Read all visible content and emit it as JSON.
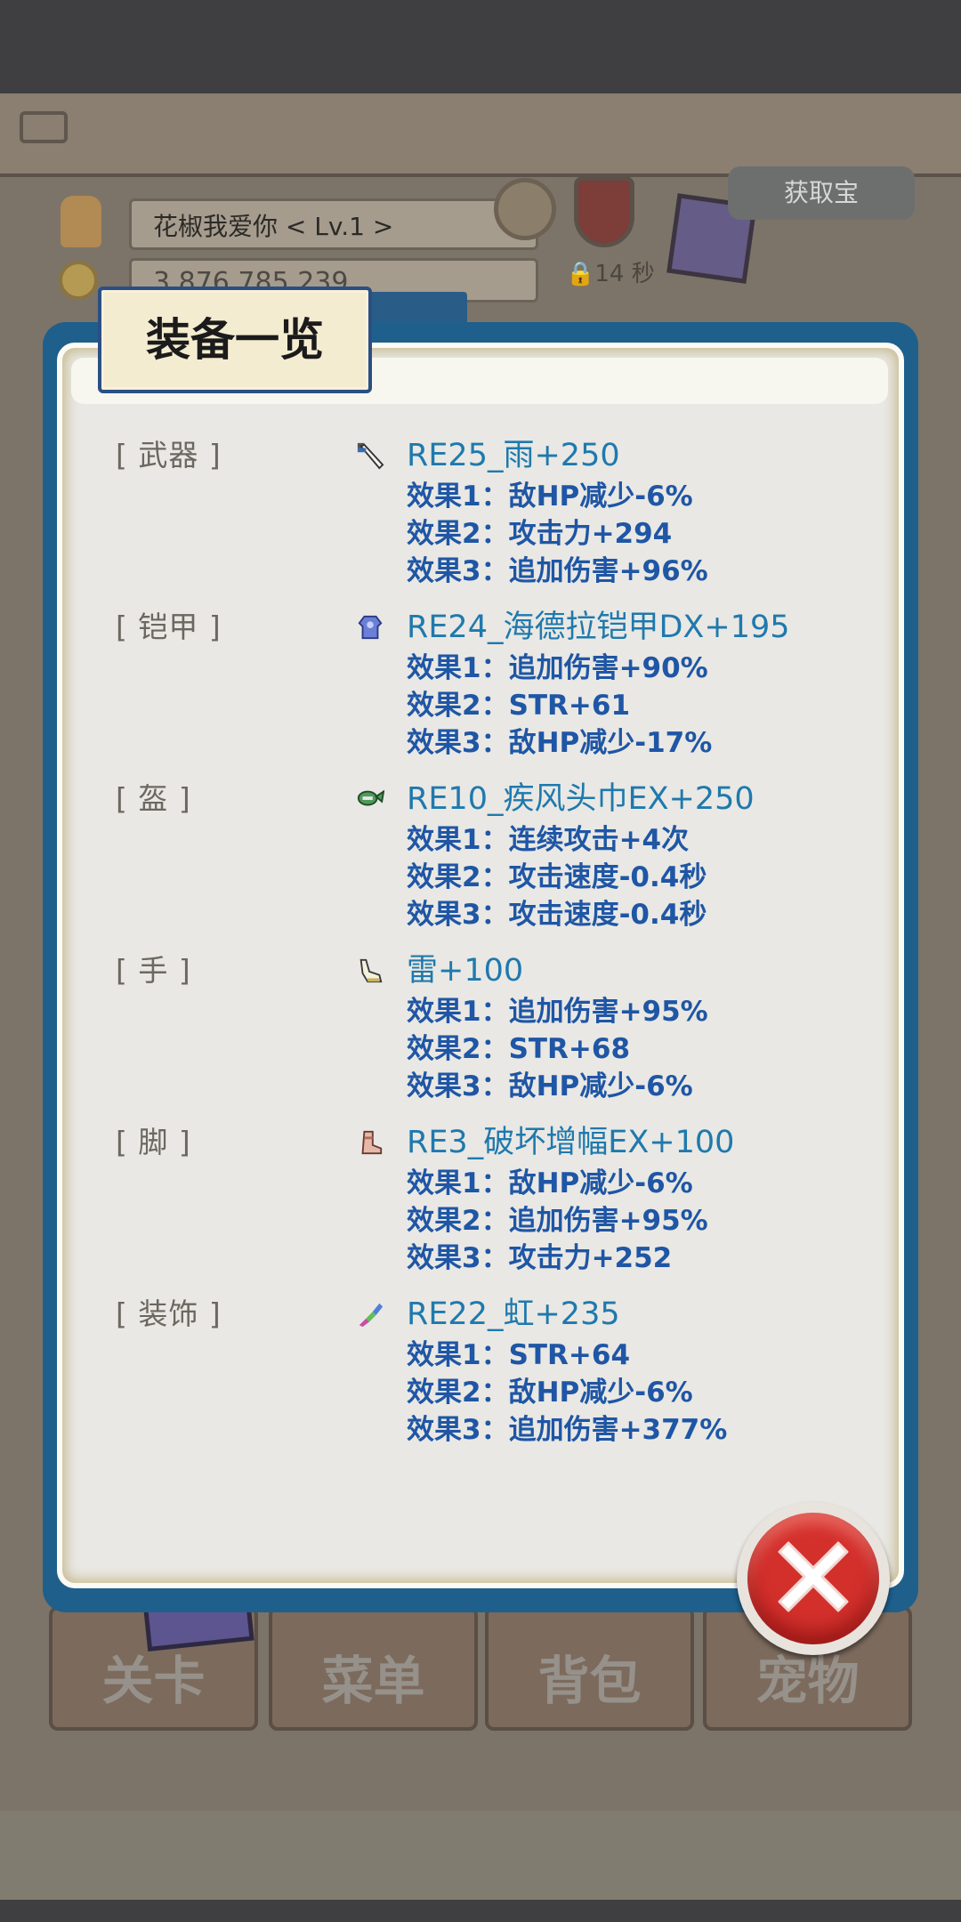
{
  "background": {
    "player_name": "花椒我爱你    < Lv.1 >",
    "gold": "3,876,785,239",
    "timer": "14 秒",
    "top_right_button": "获取宝",
    "tabs": [
      "关卡",
      "菜单",
      "背包",
      "宠物"
    ]
  },
  "dialog": {
    "title": "装备一览",
    "slots": [
      {
        "label": "[ 武器 ]",
        "icon": "sword-icon",
        "item": "RE25_雨+250",
        "effects": [
          "效果1：敌HP减少-6%",
          "效果2：攻击力+294",
          "效果3：追加伤害+96%"
        ]
      },
      {
        "label": "[ 铠甲 ]",
        "icon": "armor-icon",
        "item": "RE24_海德拉铠甲DX+195",
        "effects": [
          "效果1：追加伤害+90%",
          "效果2：STR+61",
          "效果3：敌HP减少-17%"
        ]
      },
      {
        "label": "[ 盔 ]",
        "icon": "helmet-icon",
        "item": "RE10_疾风头巾EX+250",
        "effects": [
          "效果1：连续攻击+4次",
          "效果2：攻击速度-0.4秒",
          "效果3：攻击速度-0.4秒"
        ]
      },
      {
        "label": "[ 手 ]",
        "icon": "glove-icon",
        "item": "雷+100",
        "effects": [
          "效果1：追加伤害+95%",
          "效果2：STR+68",
          "效果3：敌HP减少-6%"
        ]
      },
      {
        "label": "[ 脚 ]",
        "icon": "boot-icon",
        "item": "RE3_破坏增幅EX+100",
        "effects": [
          "效果1：敌HP减少-6%",
          "效果2：追加伤害+95%",
          "效果3：攻击力+252"
        ]
      },
      {
        "label": "[ 装饰 ]",
        "icon": "accessory-icon",
        "item": "RE22_虹+235",
        "effects": [
          "效果1：STR+64",
          "效果2：敌HP减少-6%",
          "效果3：追加伤害+377%"
        ]
      }
    ]
  },
  "colors": {
    "dialog_frame": "#1e5f8c",
    "item_name": "#1f79ad",
    "effect_text": "#1f56a5",
    "close_button": "#d3302c"
  }
}
